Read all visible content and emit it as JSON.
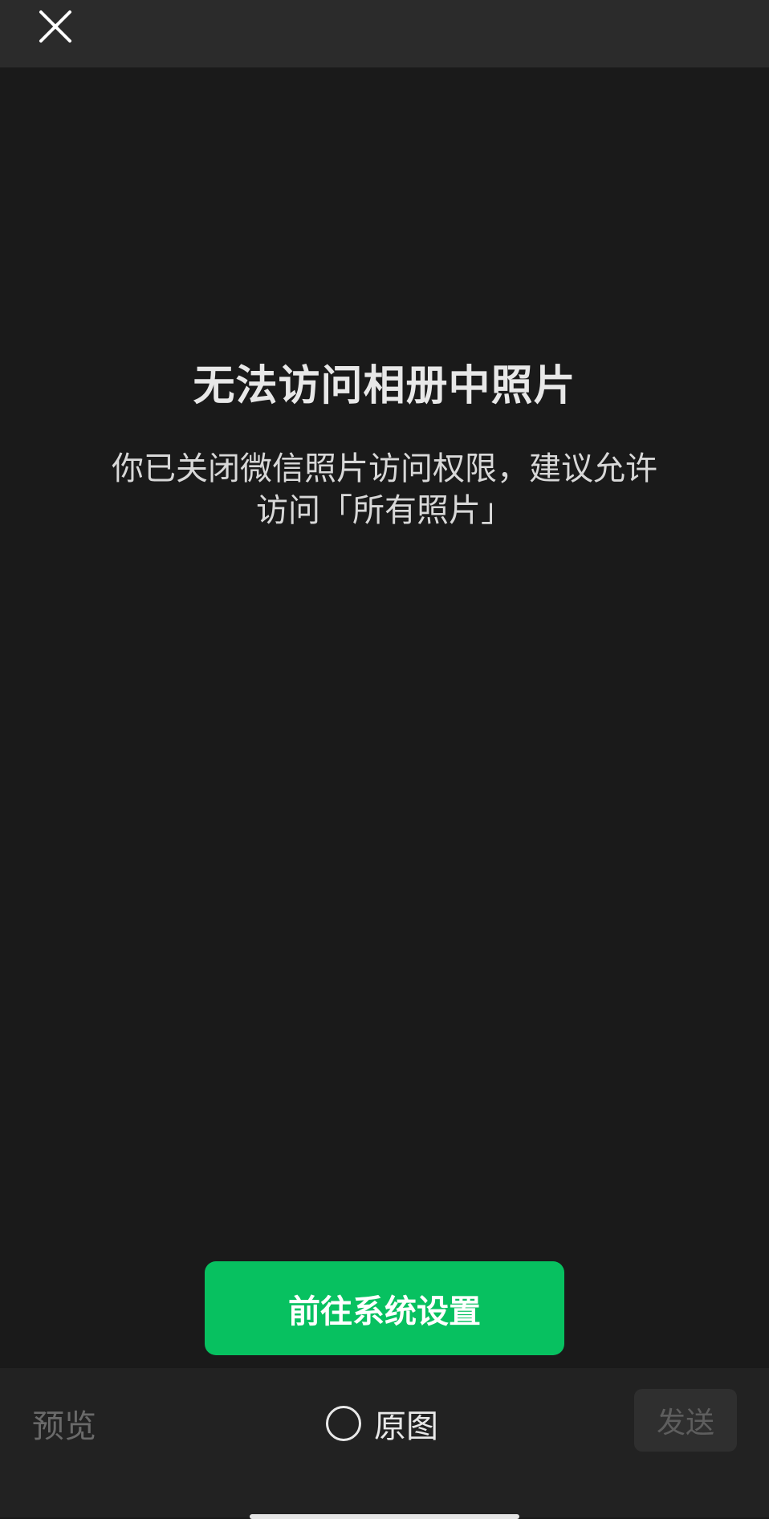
{
  "header": {
    "close_icon": "close-icon"
  },
  "message": {
    "title": "无法访问相册中照片",
    "description_line1": "你已关闭微信照片访问权限，建议允许",
    "description_line2": "访问「所有照片」"
  },
  "actions": {
    "settings_button_label": "前往系统设置"
  },
  "bottom_bar": {
    "preview_label": "预览",
    "original_label": "原图",
    "send_label": "发送"
  },
  "colors": {
    "background": "#1a1a1a",
    "top_bar": "#2b2b2b",
    "accent_green": "#07c160",
    "disabled_button": "#2f2f2f"
  }
}
